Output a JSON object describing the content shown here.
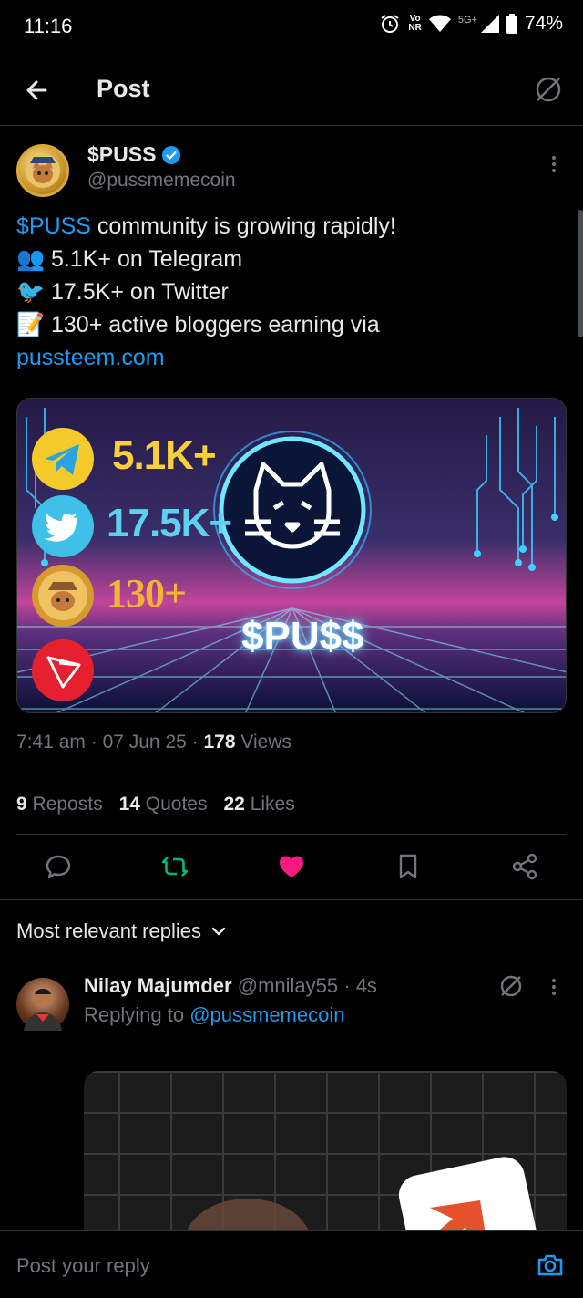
{
  "status_bar": {
    "time": "11:16",
    "volte_top": "Vo",
    "volte_bottom": "NR",
    "network": "5G+",
    "battery": "74%"
  },
  "header": {
    "title": "Post"
  },
  "post": {
    "author_name": "$PUSS",
    "author_handle": "@pussmemecoin",
    "text_line1_link": "$PUSS",
    "text_line1_rest": " community is growing rapidly!",
    "text_line2": "5.1K+ on Telegram",
    "text_line3": "17.5K+ on Twitter",
    "text_line4": "130+ active bloggers earning via",
    "text_line5_link": "pussteem.com",
    "emoji": {
      "people": "👥",
      "bird": "🐦",
      "memo": "📝"
    },
    "image": {
      "stat1": "5.1K+",
      "stat2": "17.5K+",
      "stat3": "130+",
      "brand": "$PU$$"
    },
    "time": "7:41 am",
    "date": "07 Jun 25",
    "views_count": "178",
    "views_label": "Views",
    "reposts_count": "9",
    "reposts_label": "Reposts",
    "quotes_count": "14",
    "quotes_label": "Quotes",
    "likes_count": "22",
    "likes_label": "Likes"
  },
  "replies_filter": {
    "label": "Most relevant replies"
  },
  "reply": {
    "author_name": "Nilay Majumder",
    "author_handle": "@mnilay55",
    "time": "4s",
    "replying_prefix": "Replying to ",
    "replying_to": "@pussmemecoin"
  },
  "composer": {
    "placeholder": "Post your reply"
  },
  "colors": {
    "accent": "#1d9bf0",
    "like": "#f91880",
    "repost": "#00ba7c",
    "muted": "#71767b",
    "divider": "#2f3336"
  }
}
